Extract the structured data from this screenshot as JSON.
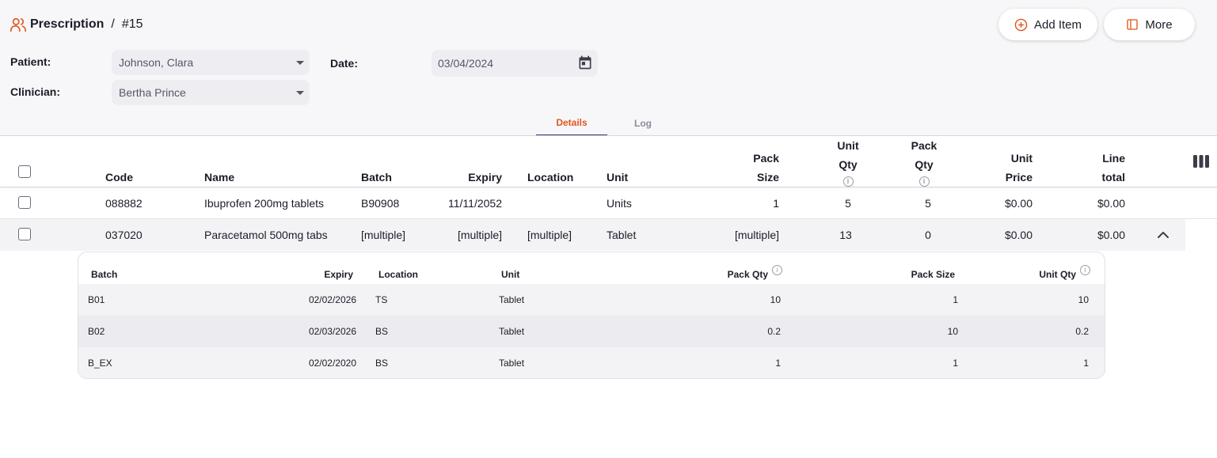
{
  "header": {
    "title": "Prescription",
    "separator": "/",
    "number": "#15",
    "add_item_label": "Add Item",
    "more_label": "More"
  },
  "form": {
    "patient_label": "Patient:",
    "patient_value": "Johnson, Clara",
    "clinician_label": "Clinician:",
    "clinician_value": "Bertha Prince",
    "date_label": "Date:",
    "date_value": "03/04/2024"
  },
  "tabs": [
    {
      "label": "Details",
      "active": true
    },
    {
      "label": "Log",
      "active": false
    }
  ],
  "table": {
    "headers": {
      "code": "Code",
      "name": "Name",
      "batch": "Batch",
      "expiry": "Expiry",
      "location": "Location",
      "unit": "Unit",
      "pack_size_1": "Pack",
      "pack_size_2": "Size",
      "unit_qty_1": "Unit",
      "unit_qty_2": "Qty",
      "pack_qty_1": "Pack",
      "pack_qty_2": "Qty",
      "unit_price_1": "Unit",
      "unit_price_2": "Price",
      "line_total_1": "Line",
      "line_total_2": "total"
    },
    "rows": [
      {
        "code": "088882",
        "name": "Ibuprofen 200mg tablets",
        "batch": "B90908",
        "expiry": "11/11/2052",
        "location": "",
        "unit": "Units",
        "pack_size": "1",
        "unit_qty": "5",
        "pack_qty": "5",
        "unit_price": "$0.00",
        "line_total": "$0.00"
      },
      {
        "code": "037020",
        "name": "Paracetamol 500mg tabs",
        "batch": "[multiple]",
        "expiry": "[multiple]",
        "location": "[multiple]",
        "unit": "Tablet",
        "pack_size": "[multiple]",
        "unit_qty": "13",
        "pack_qty": "0",
        "unit_price": "$0.00",
        "line_total": "$0.00"
      }
    ]
  },
  "nested": {
    "headers": {
      "batch": "Batch",
      "expiry": "Expiry",
      "location": "Location",
      "unit": "Unit",
      "pack_qty": "Pack Qty",
      "pack_size": "Pack Size",
      "unit_qty": "Unit Qty"
    },
    "rows": [
      {
        "batch": "B01",
        "expiry": "02/02/2026",
        "location": "TS",
        "unit": "Tablet",
        "pack_qty": "10",
        "pack_size": "1",
        "unit_qty": "10"
      },
      {
        "batch": "B02",
        "expiry": "02/03/2026",
        "location": "BS",
        "unit": "Tablet",
        "pack_qty": "0.2",
        "pack_size": "10",
        "unit_qty": "0.2"
      },
      {
        "batch": "B_EX",
        "expiry": "02/02/2020",
        "location": "BS",
        "unit": "Tablet",
        "pack_qty": "1",
        "pack_size": "1",
        "unit_qty": "1"
      }
    ]
  },
  "icons": {
    "accent": "#e2561c",
    "header": "users-icon",
    "add": "plus-circle-icon",
    "more": "panel-icon",
    "date": "calendar-icon",
    "columns": "columns-icon",
    "collapse": "chevron-up-icon",
    "info": "info-icon"
  }
}
